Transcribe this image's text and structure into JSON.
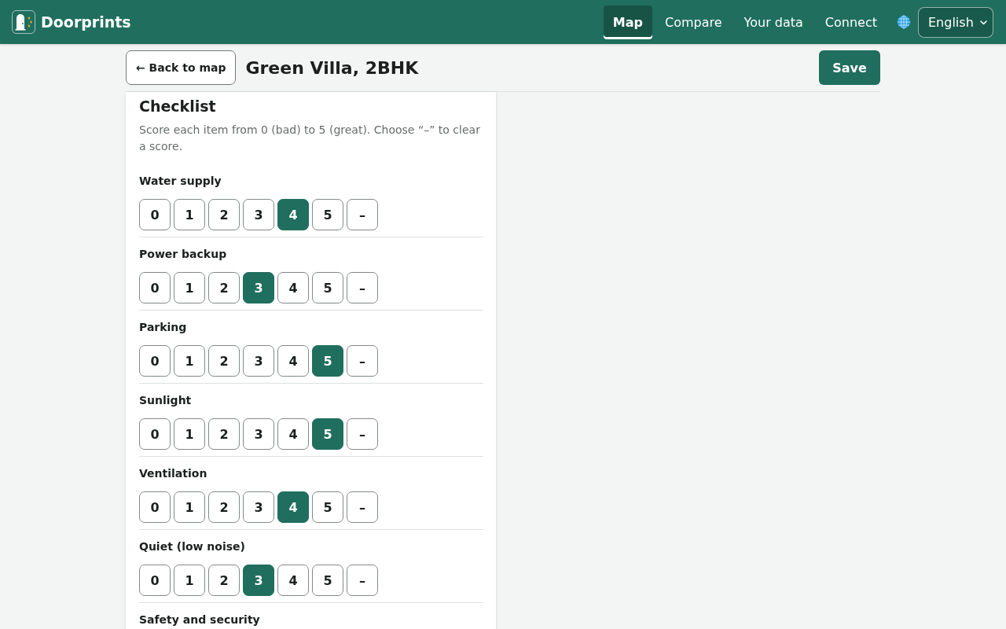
{
  "header": {
    "brand": "Doorprints",
    "nav": [
      {
        "label": "Map",
        "selected": true
      },
      {
        "label": "Compare",
        "selected": false
      },
      {
        "label": "Your data",
        "selected": false
      },
      {
        "label": "Connect",
        "selected": false
      }
    ],
    "language": {
      "value": "English"
    }
  },
  "toolbar": {
    "back_button": "← Back to map",
    "title": "Green Villa, 2BHK",
    "save_button": "Save"
  },
  "checklist": {
    "title": "Checklist",
    "description": "Score each item from 0 (bad) to 5 (great). Choose “–” to clear a score.",
    "items": [
      {
        "label": "Water supply",
        "options": [
          {
            "label": "0",
            "selected": false
          },
          {
            "label": "1",
            "selected": false
          },
          {
            "label": "2",
            "selected": false
          },
          {
            "label": "3",
            "selected": false
          },
          {
            "label": "4",
            "selected": true
          },
          {
            "label": "5",
            "selected": false
          },
          {
            "label": "–",
            "selected": false
          }
        ]
      },
      {
        "label": "Power backup",
        "options": [
          {
            "label": "0",
            "selected": false
          },
          {
            "label": "1",
            "selected": false
          },
          {
            "label": "2",
            "selected": false
          },
          {
            "label": "3",
            "selected": true
          },
          {
            "label": "4",
            "selected": false
          },
          {
            "label": "5",
            "selected": false
          },
          {
            "label": "–",
            "selected": false
          }
        ]
      },
      {
        "label": "Parking",
        "options": [
          {
            "label": "0",
            "selected": false
          },
          {
            "label": "1",
            "selected": false
          },
          {
            "label": "2",
            "selected": false
          },
          {
            "label": "3",
            "selected": false
          },
          {
            "label": "4",
            "selected": false
          },
          {
            "label": "5",
            "selected": true
          },
          {
            "label": "–",
            "selected": false
          }
        ]
      },
      {
        "label": "Sunlight",
        "options": [
          {
            "label": "0",
            "selected": false
          },
          {
            "label": "1",
            "selected": false
          },
          {
            "label": "2",
            "selected": false
          },
          {
            "label": "3",
            "selected": false
          },
          {
            "label": "4",
            "selected": false
          },
          {
            "label": "5",
            "selected": true
          },
          {
            "label": "–",
            "selected": false
          }
        ]
      },
      {
        "label": "Ventilation",
        "options": [
          {
            "label": "0",
            "selected": false
          },
          {
            "label": "1",
            "selected": false
          },
          {
            "label": "2",
            "selected": false
          },
          {
            "label": "3",
            "selected": false
          },
          {
            "label": "4",
            "selected": true
          },
          {
            "label": "5",
            "selected": false
          },
          {
            "label": "–",
            "selected": false
          }
        ]
      },
      {
        "label": "Quiet (low noise)",
        "options": [
          {
            "label": "0",
            "selected": false
          },
          {
            "label": "1",
            "selected": false
          },
          {
            "label": "2",
            "selected": false
          },
          {
            "label": "3",
            "selected": true
          },
          {
            "label": "4",
            "selected": false
          },
          {
            "label": "5",
            "selected": false
          },
          {
            "label": "–",
            "selected": false
          }
        ]
      },
      {
        "label": "Safety and security"
      }
    ]
  }
}
